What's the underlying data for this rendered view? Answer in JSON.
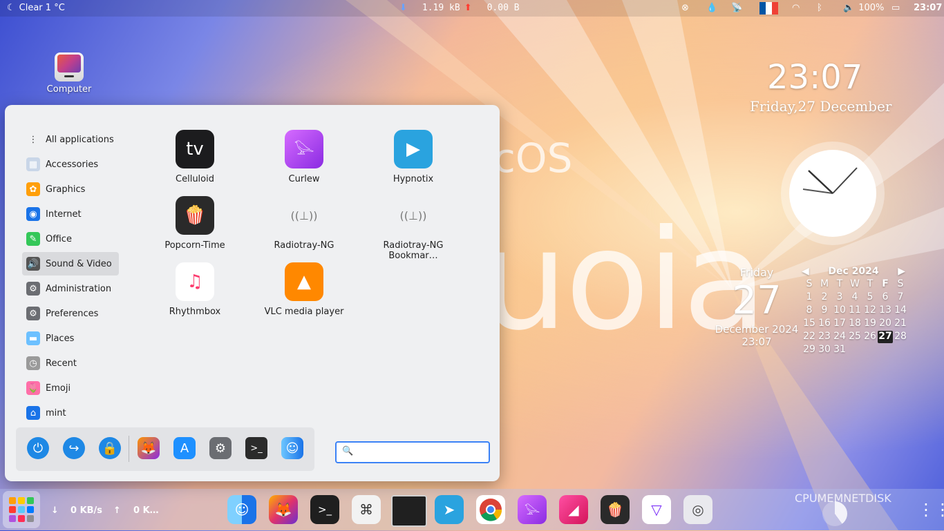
{
  "topbar": {
    "weather": "Clear 1 °C",
    "download_speed": "1.19 kB",
    "upload_speed": "0.00  B",
    "battery": "100%",
    "time": "23:07"
  },
  "desktop": {
    "computer_label": "Computer",
    "watermark_small": "macOS",
    "watermark_large": "Sequoia"
  },
  "menu": {
    "categories": [
      {
        "label": "All applications",
        "icon": "grid-icon"
      },
      {
        "label": "Accessories",
        "icon": "accessories-icon"
      },
      {
        "label": "Graphics",
        "icon": "photos-icon"
      },
      {
        "label": "Internet",
        "icon": "safari-icon"
      },
      {
        "label": "Office",
        "icon": "office-icon"
      },
      {
        "label": "Sound & Video",
        "icon": "speaker-icon"
      },
      {
        "label": "Administration",
        "icon": "gear-icon"
      },
      {
        "label": "Preferences",
        "icon": "gear-icon"
      },
      {
        "label": "Places",
        "icon": "folder-icon"
      },
      {
        "label": "Recent",
        "icon": "clock-icon"
      },
      {
        "label": "Emoji",
        "icon": "tulip-icon"
      },
      {
        "label": "mint",
        "icon": "home-icon"
      }
    ],
    "apps": [
      {
        "label": "Celluloid",
        "icon": "appletv-icon"
      },
      {
        "label": "Curlew",
        "icon": "curlew-icon"
      },
      {
        "label": "Hypnotix",
        "icon": "hypnotix-icon"
      },
      {
        "label": "Popcorn-Time",
        "icon": "popcorn-icon"
      },
      {
        "label": "Radiotray-NG",
        "icon": "radio-tower-icon"
      },
      {
        "label": "Radiotray-NG Bookmar…",
        "icon": "radio-tower-icon"
      },
      {
        "label": "Rhythmbox",
        "icon": "music-icon"
      },
      {
        "label": "VLC media player",
        "icon": "vlc-cone-icon"
      }
    ],
    "search_placeholder": ""
  },
  "clock": {
    "time": "23:07",
    "date": "Friday,27 December"
  },
  "calendar_widget": {
    "weekday": "Friday",
    "day": "27",
    "month_year": "December 2024",
    "time": "23:07",
    "header": "Dec 2024",
    "weekdays": [
      "S",
      "M",
      "T",
      "W",
      "T",
      "F",
      "S"
    ],
    "days": [
      "1",
      "2",
      "3",
      "4",
      "5",
      "6",
      "7",
      "8",
      "9",
      "10",
      "11",
      "12",
      "13",
      "14",
      "15",
      "16",
      "17",
      "18",
      "19",
      "20",
      "21",
      "22",
      "23",
      "24",
      "25",
      "26",
      "27",
      "28",
      "29",
      "30",
      "31"
    ],
    "today": "27"
  },
  "dock": {
    "net_down": "0 KB/s",
    "net_up": "0 K…",
    "sysmon_label": "CPUMEMNETDISK"
  },
  "colors": {
    "accent": "#3b82f6",
    "menu_bg": "#eff0f2"
  }
}
